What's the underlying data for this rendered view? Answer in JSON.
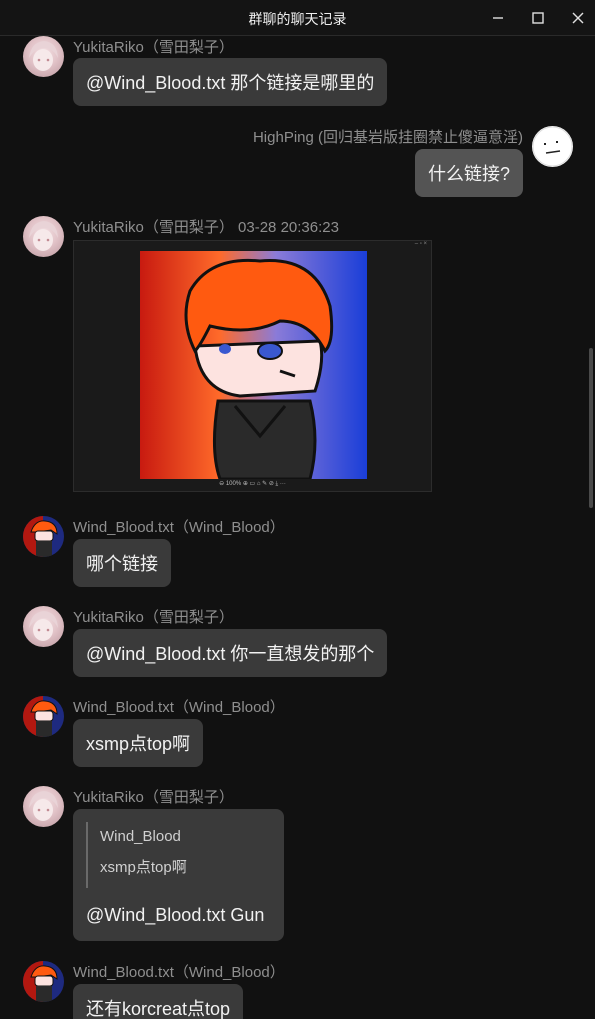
{
  "window": {
    "title": "群聊的聊天记录"
  },
  "messages": [
    {
      "sender": "YukitaRiko（雪田梨子）",
      "text": "@Wind_Blood.txt 那个链接是哪里的"
    },
    {
      "sender": "HighPing (回归基岩版挂圈禁止傻逼意淫)",
      "text": "什么链接?"
    },
    {
      "sender": "YukitaRiko（雪田梨子）  03-28 20:36:23",
      "image_toolbar": "⊖  100%  ⊕  ▭     ⌂  ✎  ⊘  ⤓  ···"
    },
    {
      "sender": "Wind_Blood.txt（Wind_Blood）",
      "text": "哪个链接"
    },
    {
      "sender": "YukitaRiko（雪田梨子）",
      "text": "@Wind_Blood.txt 你一直想发的那个"
    },
    {
      "sender": "Wind_Blood.txt（Wind_Blood）",
      "text": "xsmp点top啊"
    },
    {
      "sender": "YukitaRiko（雪田梨子）",
      "quote_name": "Wind_Blood",
      "quote_text": "xsmp点top啊",
      "text": "@Wind_Blood.txt Gun"
    },
    {
      "sender": "Wind_Blood.txt（Wind_Blood）",
      "text": "还有korcreat点top"
    }
  ],
  "colors": {
    "background": "#111111",
    "bubble": "#3a3a3a",
    "self_bubble": "#545454"
  }
}
